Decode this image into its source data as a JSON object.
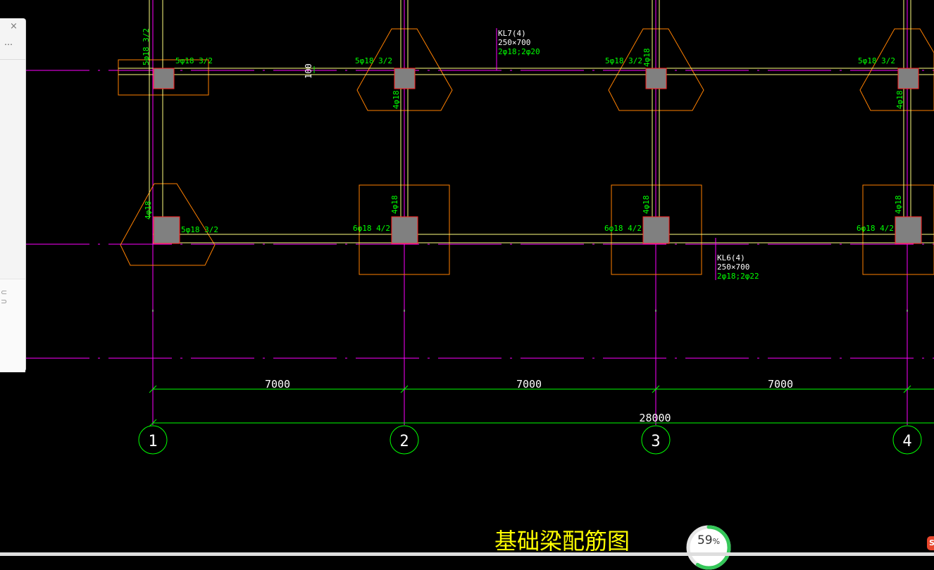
{
  "colors": {
    "background": "#000000",
    "axis": "#ff00ff",
    "beam": "#ffff80",
    "rebar_text": "#00ff00",
    "footing": "#ff8000",
    "column_fill": "#808080",
    "column_edge": "#ff2020",
    "dimension": "#00ff00",
    "label": "#ffffff",
    "title": "#ffff00",
    "progress_track": "#e6e6e6",
    "progress_arc": "#35c759",
    "badge": "#e8462c"
  },
  "side_panel": {
    "close_icon": "×",
    "more_icon": "⋯"
  },
  "drawing": {
    "top_rebar_label": "5φ18 3/2",
    "top_col_rebar": "4φ18",
    "col1_top_vertical": "5φ18 3/2",
    "bottom_rebar_col1": "5φ18 3/2",
    "bottom_rebar_other": "6φ18 4/2",
    "dim_100": "100",
    "beams": [
      {
        "name": "KL7(4)",
        "size": "250×700",
        "rebar": "2φ18;2φ20"
      },
      {
        "name": "KL6(4)",
        "size": "250×700",
        "rebar": "2φ18;2φ22"
      }
    ],
    "dimensions": [
      "7000",
      "7000",
      "7000"
    ],
    "total_dimension": "28000",
    "axis_labels": [
      "1",
      "2",
      "3",
      "4"
    ],
    "title": "基础梁配筋图"
  },
  "progress": {
    "value": 0.59,
    "label": "59",
    "unit": "%"
  },
  "corner_badge": "S"
}
